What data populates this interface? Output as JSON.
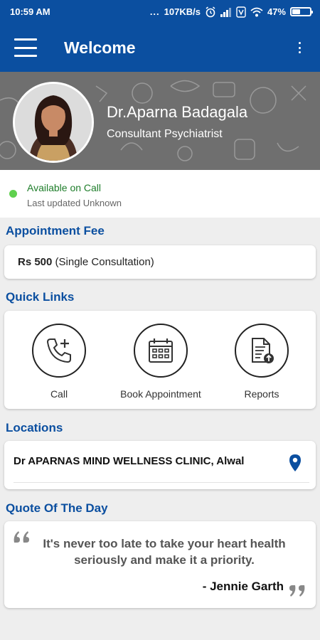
{
  "status_bar": {
    "time": "10:59 AM",
    "dots": "...",
    "speed": "107KB/s",
    "battery": "47%",
    "battery_level": 0.47,
    "icons": [
      "alarm-icon",
      "signal-icon",
      "volte-icon",
      "wifi-icon",
      "battery-icon"
    ]
  },
  "app_bar": {
    "title": "Welcome",
    "menu_icon": "hamburger-menu-icon",
    "overflow_icon": "more-vertical-icon"
  },
  "doctor": {
    "name": "Dr.Aparna Badagala",
    "title": "Consultant Psychiatrist"
  },
  "availability": {
    "status": "Available on Call",
    "last_updated": "Last updated Unknown",
    "status_color": "#5fd04e"
  },
  "appointment_fee": {
    "heading": "Appointment Fee",
    "amount": "Rs 500",
    "note": " (Single Consultation)"
  },
  "quick_links": {
    "heading": "Quick Links",
    "items": [
      {
        "label": "Call",
        "icon": "phone-plus-icon"
      },
      {
        "label": "Book Appointment",
        "icon": "calendar-icon"
      },
      {
        "label": "Reports",
        "icon": "document-upload-icon"
      }
    ]
  },
  "locations": {
    "heading": "Locations",
    "items": [
      {
        "name": "Dr APARNAS MIND WELLNESS CLINIC, Alwal",
        "icon": "map-pin-icon"
      }
    ]
  },
  "quote": {
    "heading": "Quote Of The Day",
    "text": "It's never too late to take your heart health seriously and make it a priority.",
    "author": "- Jennie Garth"
  },
  "colors": {
    "primary": "#0b4fa0",
    "background": "#eeeeee",
    "header_gray": "#6f6f6f",
    "available_green": "#5fd04e"
  }
}
